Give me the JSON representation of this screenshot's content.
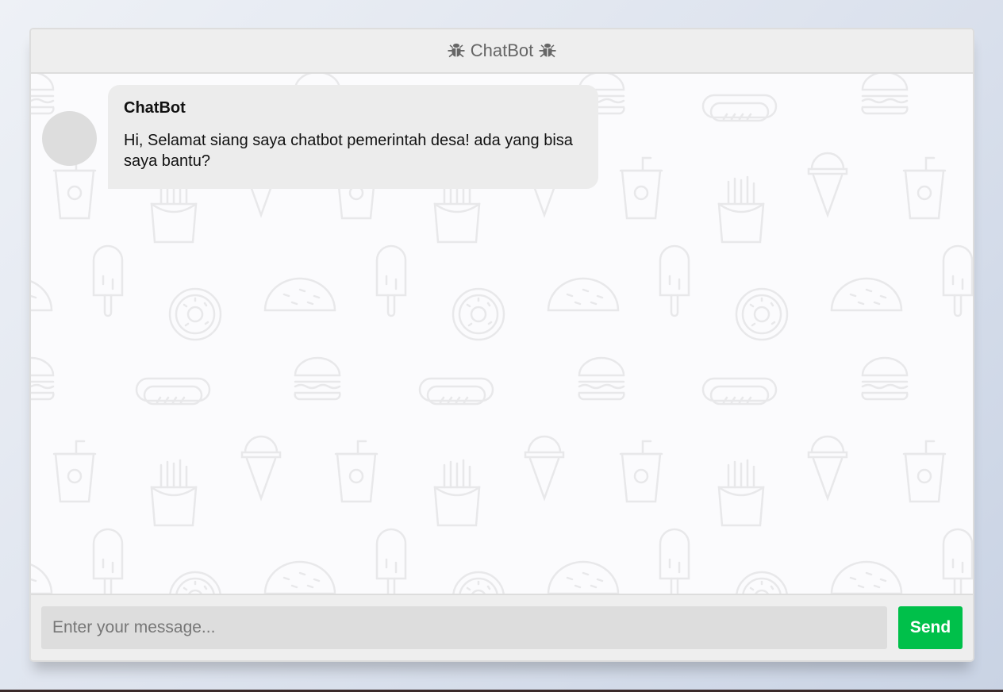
{
  "header": {
    "title": "ChatBot",
    "left_icon": "bug-icon",
    "right_icon": "bug-icon"
  },
  "messages": [
    {
      "sender": "ChatBot",
      "text": "Hi, Selamat siang saya chatbot pemerintah desa! ada yang bisa saya bantu?"
    }
  ],
  "input": {
    "placeholder": "Enter your message...",
    "value": ""
  },
  "send_button": {
    "label": "Send"
  },
  "colors": {
    "accent": "#00c04a",
    "header_bg": "#eeeeee",
    "bubble_bg": "#ececec",
    "avatar": "#dddddd"
  }
}
